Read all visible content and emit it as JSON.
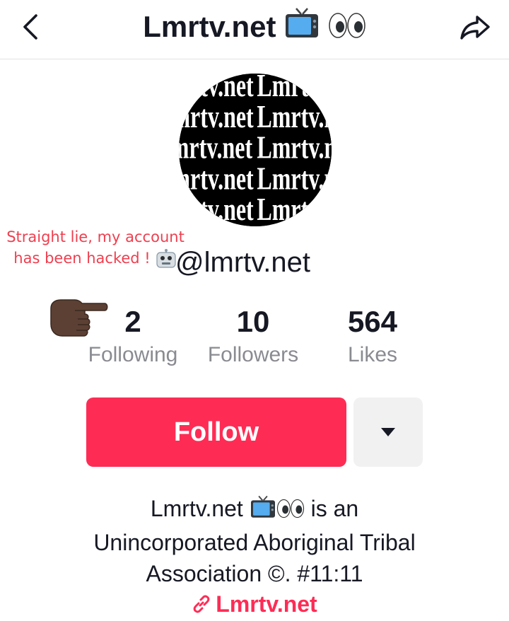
{
  "header": {
    "title": "Lmrtv.net",
    "back_icon": "chevron-left-icon",
    "share_icon": "share-arrow-icon",
    "title_emojis": [
      "tv-emoji-icon",
      "eyes-emoji-icon"
    ]
  },
  "avatar": {
    "pattern_text": "Lmrtv.net"
  },
  "overlay": {
    "line1": "Straight lie, my account",
    "line2": "has been hacked !",
    "color": "#ef3f4f",
    "icon": "robot-emoji-icon"
  },
  "profile": {
    "username": "@lmrtv.net"
  },
  "stats": {
    "following": {
      "value": "2",
      "label": "Following"
    },
    "followers": {
      "value": "10",
      "label": "Followers"
    },
    "likes": {
      "value": "564",
      "label": "Likes"
    },
    "pointer_icon": "pointing-hand-emoji-icon"
  },
  "actions": {
    "follow_label": "Follow",
    "more_icon": "caret-down-icon",
    "follow_color": "#fe2c55"
  },
  "bio": {
    "line1_start": "Lmrtv.net",
    "line1_end": "is an",
    "line2": "Unincorporated Aboriginal Tribal",
    "line3": "Association ©. #11:11"
  },
  "link": {
    "text": "Lmrtv.net",
    "icon": "link-icon",
    "color": "#fe2c55"
  }
}
